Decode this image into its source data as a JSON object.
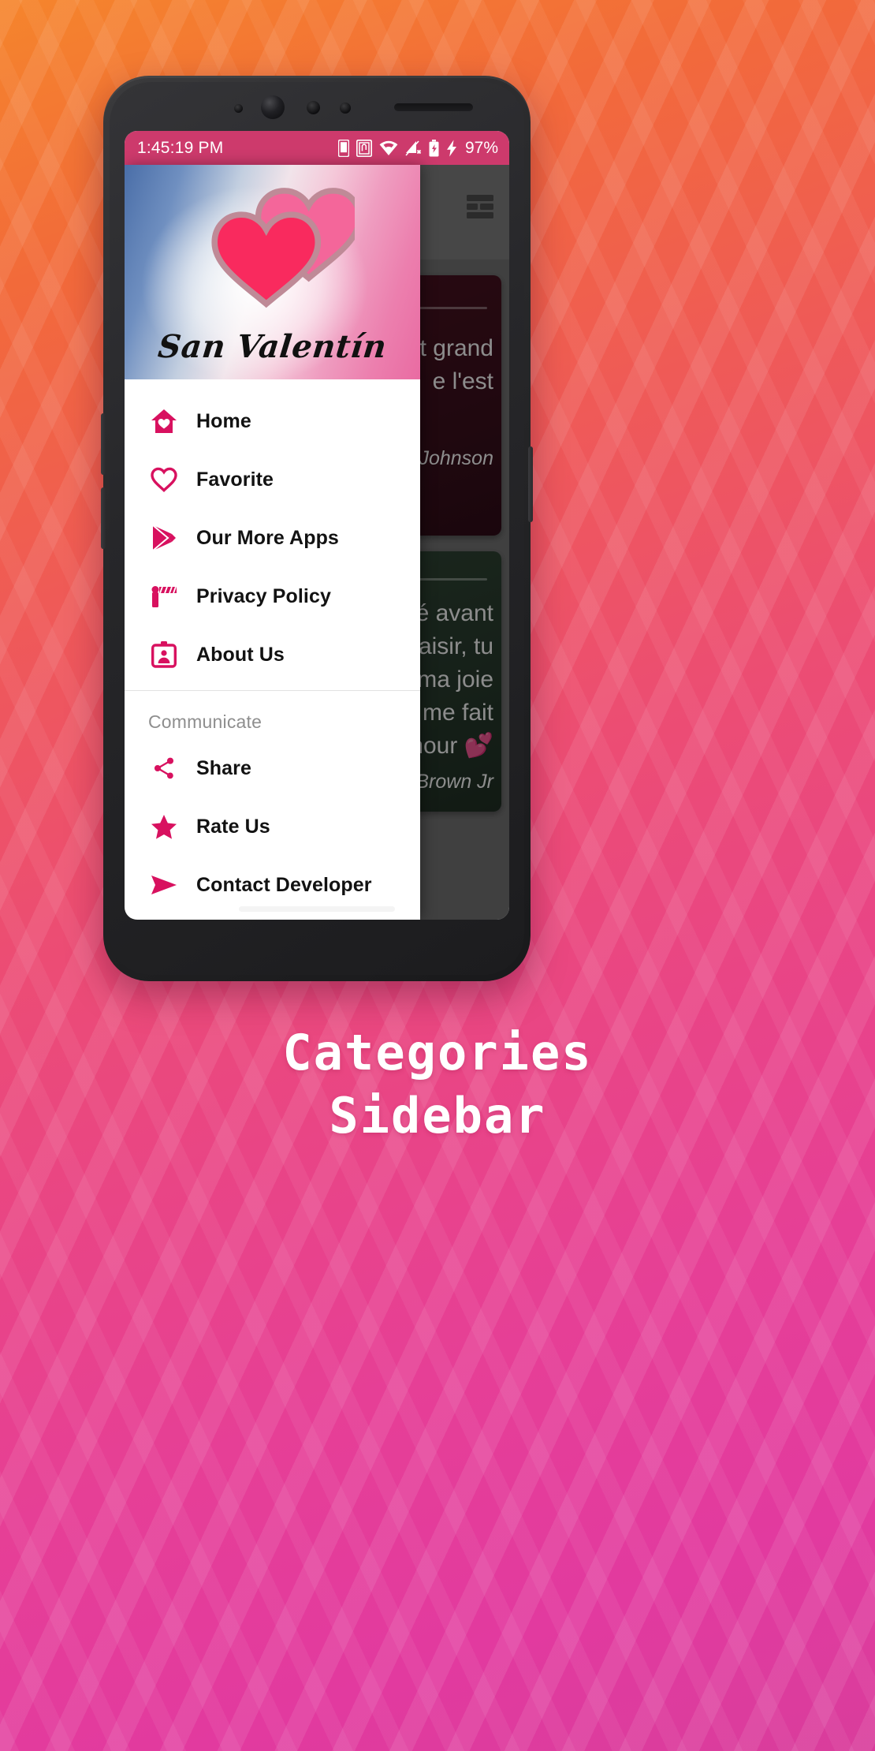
{
  "caption": {
    "line1": "Categories",
    "line2": "Sidebar"
  },
  "statusbar": {
    "time": "1:45:19 PM",
    "battery_percent": "97%",
    "icons": [
      "phone-icon",
      "nfc-icon",
      "wifi-icon",
      "signal-off-icon",
      "battery-charging-icon",
      "bolt-icon"
    ],
    "background_color": "#cd3a6c"
  },
  "drawer": {
    "app_title": "San Valentín",
    "header_logo": "double-heart-icon",
    "accent_color": "#d8115f",
    "items": [
      {
        "label": "Home",
        "icon": "home-heart-icon"
      },
      {
        "label": "Favorite",
        "icon": "heart-outline-icon"
      },
      {
        "label": "Our More Apps",
        "icon": "play-store-icon"
      },
      {
        "label": "Privacy Policy",
        "icon": "barrier-gate-icon"
      },
      {
        "label": "About Us",
        "icon": "id-badge-icon"
      }
    ],
    "group_label": "Communicate",
    "group_items": [
      {
        "label": "Share",
        "icon": "share-nodes-icon"
      },
      {
        "label": "Rate Us",
        "icon": "star-icon"
      },
      {
        "label": "Contact Developer",
        "icon": "send-icon"
      }
    ]
  },
  "app_behind": {
    "menu_icon": "grid-view-icon",
    "cards": [
      {
        "text_line1": "t grand",
        "text_line2": "e l'est",
        "author": "el Johnson",
        "share_icon": "share-icon"
      },
      {
        "text_line1": "sé avant",
        "text_line2": "plaisir, tu",
        "text_line3": "s ma joie",
        "text_line4": "me fait",
        "text_line5": "mour 💕",
        "author": "Brown  Jr",
        "share_icon": "share-icon"
      }
    ]
  }
}
